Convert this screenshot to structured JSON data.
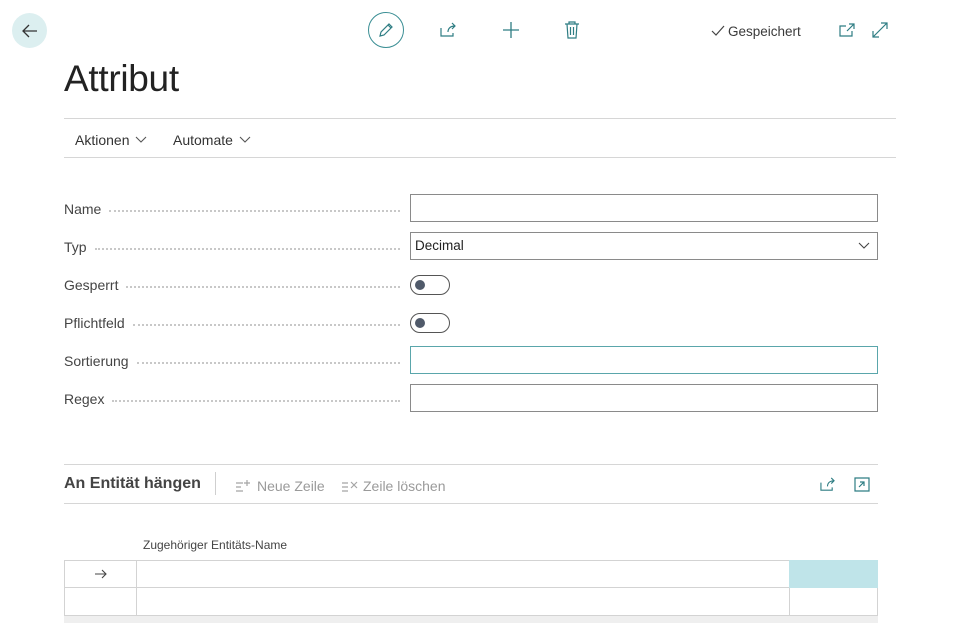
{
  "header": {
    "status": "Gespeichert",
    "page_title": "Attribut"
  },
  "menu": {
    "items": [
      {
        "label": "Aktionen"
      },
      {
        "label": "Automate"
      }
    ]
  },
  "form": {
    "name": {
      "label": "Name",
      "value": ""
    },
    "typ": {
      "label": "Typ",
      "value": "Decimal"
    },
    "gesperrt": {
      "label": "Gesperrt",
      "checked": false
    },
    "pflichtfeld": {
      "label": "Pflichtfeld",
      "checked": false
    },
    "sortierung": {
      "label": "Sortierung",
      "value": ""
    },
    "regex": {
      "label": "Regex",
      "value": ""
    }
  },
  "subpage": {
    "title": "An Entität hängen",
    "new_row": "Neue Zeile",
    "delete_row": "Zeile löschen",
    "column_header": "Zugehöriger Entitäts-Name",
    "rows": [
      {
        "entity_name": ""
      },
      {
        "entity_name": ""
      }
    ]
  },
  "colors": {
    "accent": "#3a8e94",
    "selected_cell": "#bfe4e9"
  }
}
